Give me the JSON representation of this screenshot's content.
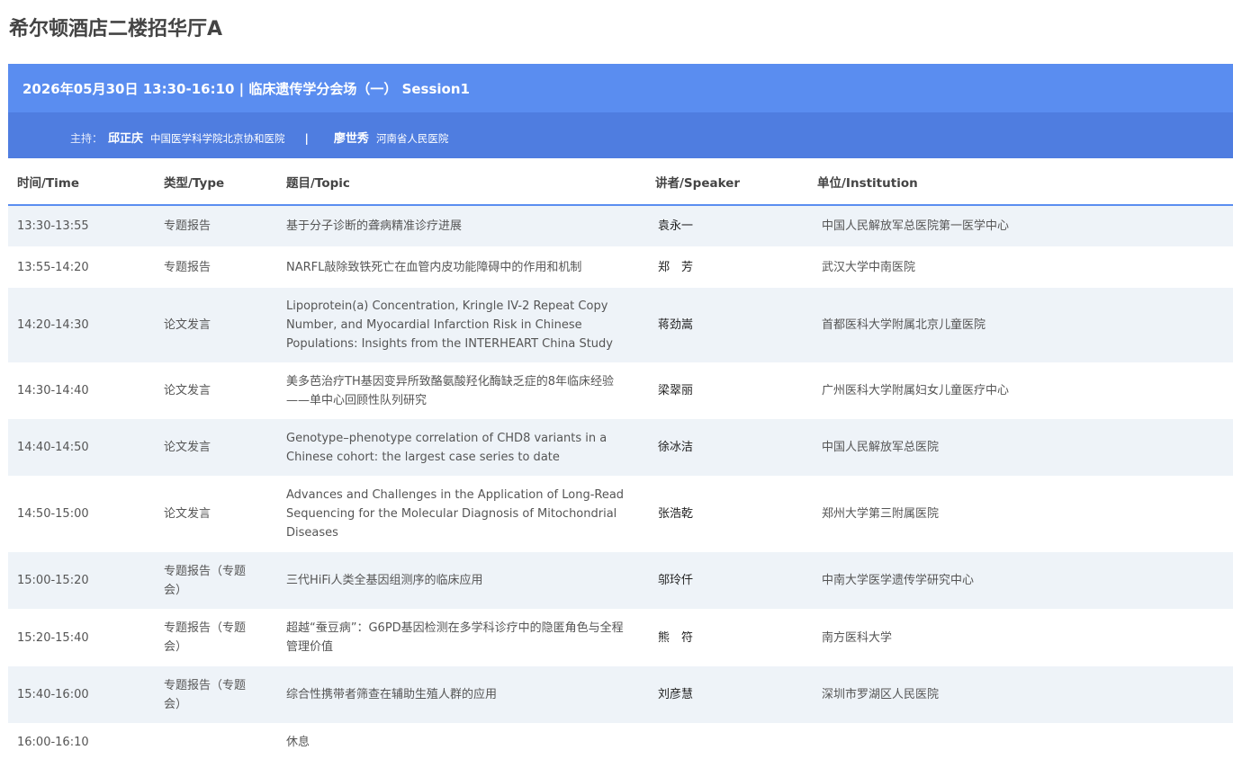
{
  "venue": "希尔顿酒店二楼招华厅A",
  "session": {
    "title": "2026年05月30日 13:30-16:10 | 临床遗传学分会场（一） Session1",
    "host_label": "主持：",
    "hosts": [
      {
        "name": "邱正庆",
        "institution": "中国医学科学院北京协和医院"
      },
      {
        "name": "廖世秀",
        "institution": "河南省人民医院"
      }
    ],
    "separator": "|"
  },
  "table": {
    "headers": {
      "time": "时间/Time",
      "type": "类型/Type",
      "topic": "题目/Topic",
      "speaker": "讲者/Speaker",
      "institution": "单位/Institution"
    },
    "rows": [
      {
        "time": "13:30-13:55",
        "type": "专题报告",
        "topic": "基于分子诊断的聋病精准诊疗进展",
        "speaker": "袁永一",
        "institution": "中国人民解放军总医院第一医学中心"
      },
      {
        "time": "13:55-14:20",
        "type": "专题报告",
        "topic": "NARFL敲除致铁死亡在血管内皮功能障碍中的作用和机制",
        "speaker": "郑　芳",
        "institution": "武汉大学中南医院"
      },
      {
        "time": "14:20-14:30",
        "type": "论文发言",
        "topic": "Lipoprotein(a) Concentration, Kringle IV-2 Repeat Copy Number, and Myocardial Infarction Risk in Chinese Populations: Insights from the INTERHEART China Study",
        "speaker": "蒋劲嵩",
        "institution": "首都医科大学附属北京儿童医院"
      },
      {
        "time": "14:30-14:40",
        "type": "论文发言",
        "topic": "美多芭治疗TH基因变异所致酪氨酸羟化酶缺乏症的8年临床经验——单中心回顾性队列研究",
        "speaker": "梁翠丽",
        "institution": "广州医科大学附属妇女儿童医疗中心"
      },
      {
        "time": "14:40-14:50",
        "type": "论文发言",
        "topic": "Genotype–phenotype correlation of CHD8 variants in a Chinese cohort: the largest case series to date",
        "speaker": "徐冰洁",
        "institution": "中国人民解放军总医院"
      },
      {
        "time": "14:50-15:00",
        "type": "论文发言",
        "topic": "Advances and Challenges in the Application of Long-Read Sequencing for the Molecular Diagnosis of Mitochondrial Diseases",
        "speaker": "张浩乾",
        "institution": "郑州大学第三附属医院"
      },
      {
        "time": "15:00-15:20",
        "type": "专题报告（专题会）",
        "topic": "三代HiFi人类全基因组测序的临床应用",
        "speaker": "邬玲仟",
        "institution": "中南大学医学遗传学研究中心"
      },
      {
        "time": "15:20-15:40",
        "type": "专题报告（专题会）",
        "topic": "超越“蚕豆病”：G6PD基因检测在多学科诊疗中的隐匿角色与全程管理价值",
        "speaker": "熊　符",
        "institution": "南方医科大学"
      },
      {
        "time": "15:40-16:00",
        "type": "专题报告（专题会）",
        "topic": "综合性携带者筛查在辅助生殖人群的应用",
        "speaker": "刘彦慧",
        "institution": "深圳市罗湖区人民医院"
      },
      {
        "time": "16:00-16:10",
        "type": "",
        "topic": "休息",
        "speaker": "",
        "institution": ""
      }
    ]
  },
  "colors": {
    "header_blue": "#5a8df0",
    "host_blue": "#4f7de0",
    "row_alt": "#eef3f8"
  }
}
